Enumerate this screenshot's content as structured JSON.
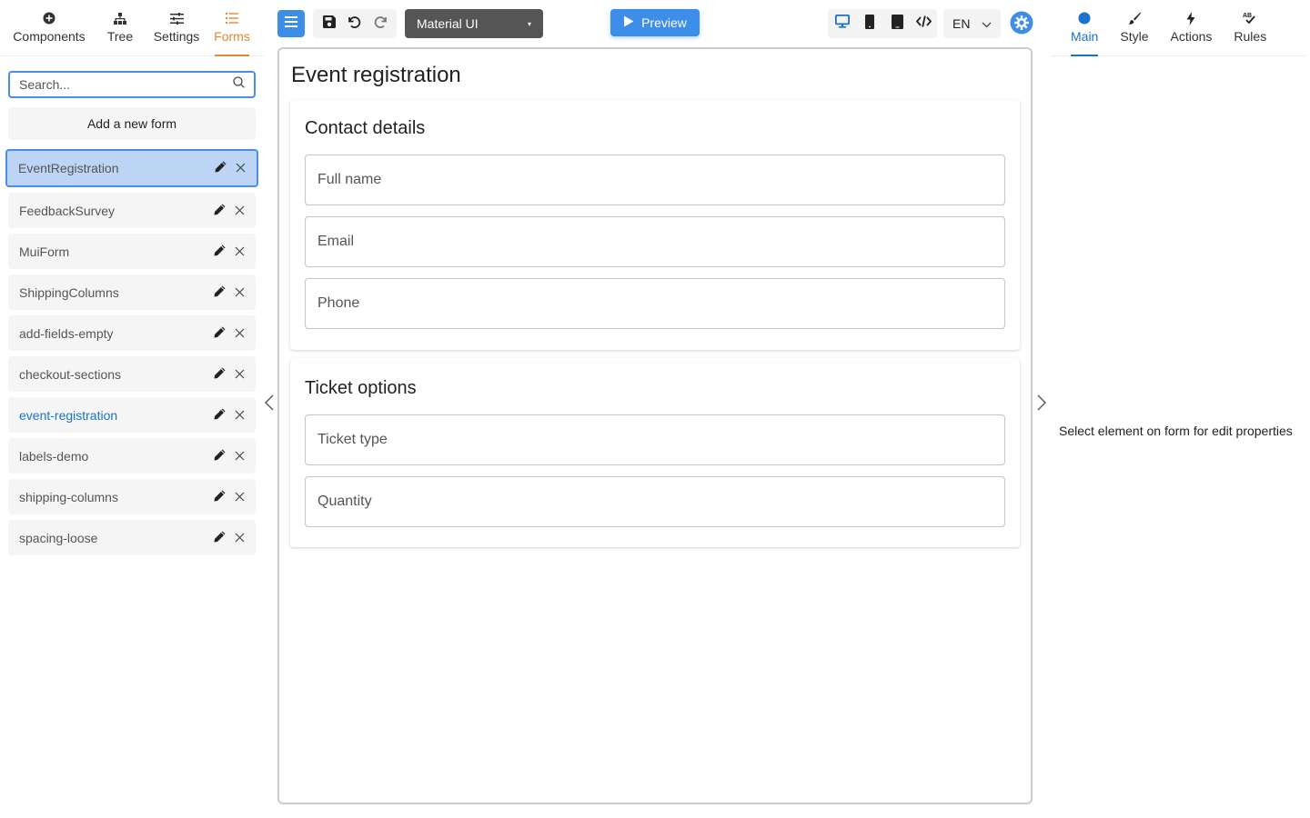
{
  "left_tabs": [
    {
      "label": "Components",
      "icon": "plus-circle-icon"
    },
    {
      "label": "Tree",
      "icon": "tree-icon"
    },
    {
      "label": "Settings",
      "icon": "sliders-icon"
    },
    {
      "label": "Forms",
      "icon": "list-icon",
      "active": true
    }
  ],
  "search": {
    "placeholder": "Search..."
  },
  "add_form_label": "Add a new form",
  "forms": [
    {
      "name": "EventRegistration",
      "selected": true
    },
    {
      "name": "FeedbackSurvey"
    },
    {
      "name": "MuiForm"
    },
    {
      "name": "ShippingColumns"
    },
    {
      "name": "add-fields-empty"
    },
    {
      "name": "checkout-sections"
    },
    {
      "name": "event-registration",
      "current": true
    },
    {
      "name": "labels-demo"
    },
    {
      "name": "shipping-columns"
    },
    {
      "name": "spacing-loose"
    }
  ],
  "toolbar": {
    "theme": "Material UI",
    "preview_label": "Preview",
    "language": "EN"
  },
  "form": {
    "title": "Event registration",
    "sections": [
      {
        "title": "Contact details",
        "fields": [
          "Full name",
          "Email",
          "Phone"
        ]
      },
      {
        "title": "Ticket options",
        "fields": [
          "Ticket type",
          "Quantity"
        ]
      }
    ]
  },
  "right_tabs": [
    {
      "label": "Main",
      "icon": "circle-icon",
      "active": true
    },
    {
      "label": "Style",
      "icon": "brush-icon"
    },
    {
      "label": "Actions",
      "icon": "bolt-icon"
    },
    {
      "label": "Rules",
      "icon": "spellcheck-icon"
    }
  ],
  "properties_hint": "Select element on form for edit properties",
  "colors": {
    "accent_blue": "#3d8ee8",
    "forms_tab_orange": "#e08a2e",
    "active_blue": "#1a73c8"
  }
}
